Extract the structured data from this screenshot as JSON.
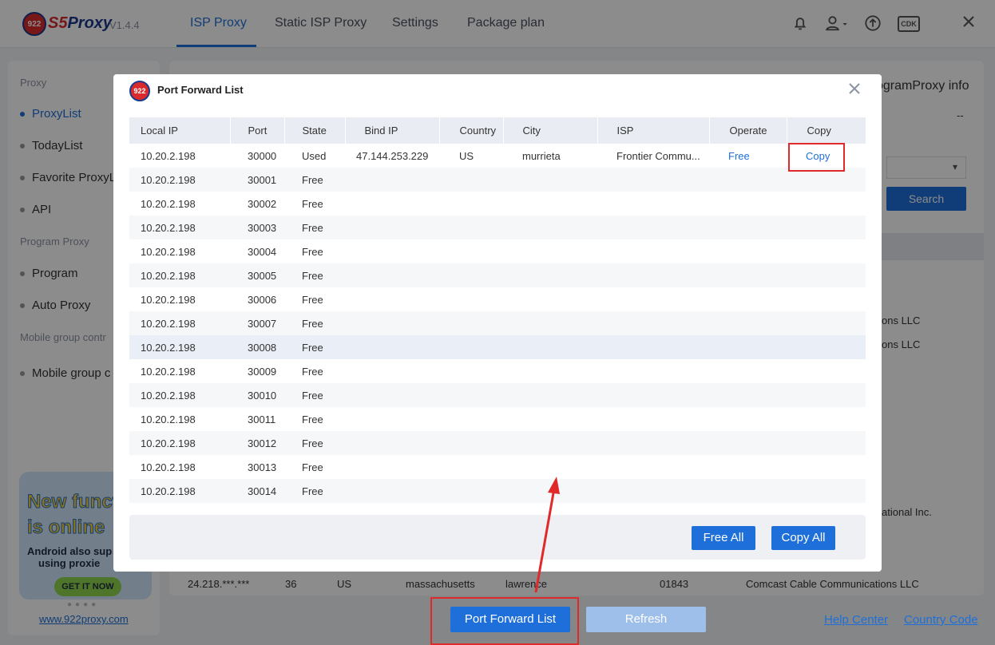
{
  "app": {
    "brand_prefix": "S5",
    "brand_suffix": "Proxy",
    "logo_text": "922",
    "version": "V1.4.4",
    "tabs": [
      "ISP Proxy",
      "Static ISP Proxy",
      "Settings",
      "Package plan"
    ],
    "cdk": "CDK"
  },
  "sidebar": {
    "sections": [
      {
        "label": "Proxy"
      },
      {
        "label": "Program Proxy"
      },
      {
        "label": "Mobile group contr"
      }
    ],
    "items": [
      "ProxyList",
      "TodayList",
      "Favorite ProxyL",
      "API",
      "Program",
      "Auto Proxy",
      "Mobile group c"
    ],
    "promo": {
      "title_line1": "New funct",
      "title_line2": "is online",
      "sub_line1": "Android also sup",
      "sub_line2": "using proxie",
      "button": "GET IT NOW"
    },
    "site_link": "www.922proxy.com"
  },
  "background": {
    "card_title": "ogramProxy info",
    "card_value": "--",
    "search_button": "Search",
    "visible_fragments": [
      "ons LLC",
      "ons LLC",
      "ational Inc."
    ],
    "last_row": {
      "ip": "24.218.***.***",
      "num": "36",
      "country": "US",
      "region": "massachusetts",
      "city": "lawrence",
      "zip": "01843",
      "isp": "Comcast Cable Communications LLC"
    }
  },
  "bottom": {
    "port_forward_list": "Port Forward List",
    "refresh": "Refresh",
    "help_center": "Help Center",
    "country_code": "Country Code"
  },
  "modal": {
    "title": "Port Forward List",
    "columns": [
      "Local IP",
      "Port",
      "State",
      "Bind IP",
      "Country",
      "City",
      "ISP",
      "Operate",
      "Copy"
    ],
    "rows": [
      {
        "local_ip": "10.20.2.198",
        "port": "30000",
        "state": "Used",
        "bind_ip": "47.144.253.229",
        "country": "US",
        "city": "murrieta",
        "isp": "Frontier Commu...",
        "operate": "Free",
        "copy": "Copy"
      },
      {
        "local_ip": "10.20.2.198",
        "port": "30001",
        "state": "Free"
      },
      {
        "local_ip": "10.20.2.198",
        "port": "30002",
        "state": "Free"
      },
      {
        "local_ip": "10.20.2.198",
        "port": "30003",
        "state": "Free"
      },
      {
        "local_ip": "10.20.2.198",
        "port": "30004",
        "state": "Free"
      },
      {
        "local_ip": "10.20.2.198",
        "port": "30005",
        "state": "Free"
      },
      {
        "local_ip": "10.20.2.198",
        "port": "30006",
        "state": "Free"
      },
      {
        "local_ip": "10.20.2.198",
        "port": "30007",
        "state": "Free"
      },
      {
        "local_ip": "10.20.2.198",
        "port": "30008",
        "state": "Free"
      },
      {
        "local_ip": "10.20.2.198",
        "port": "30009",
        "state": "Free"
      },
      {
        "local_ip": "10.20.2.198",
        "port": "30010",
        "state": "Free"
      },
      {
        "local_ip": "10.20.2.198",
        "port": "30011",
        "state": "Free"
      },
      {
        "local_ip": "10.20.2.198",
        "port": "30012",
        "state": "Free"
      },
      {
        "local_ip": "10.20.2.198",
        "port": "30013",
        "state": "Free"
      },
      {
        "local_ip": "10.20.2.198",
        "port": "30014",
        "state": "Free"
      }
    ],
    "free_all": "Free All",
    "copy_all": "Copy All"
  },
  "colors": {
    "accent": "#1e6fd9",
    "highlight": "#e02a2a",
    "brand_red": "#d92b2b",
    "brand_navy": "#1b3a8c"
  },
  "icons": [
    "bell-icon",
    "user-icon",
    "upload-icon",
    "close-icon"
  ]
}
